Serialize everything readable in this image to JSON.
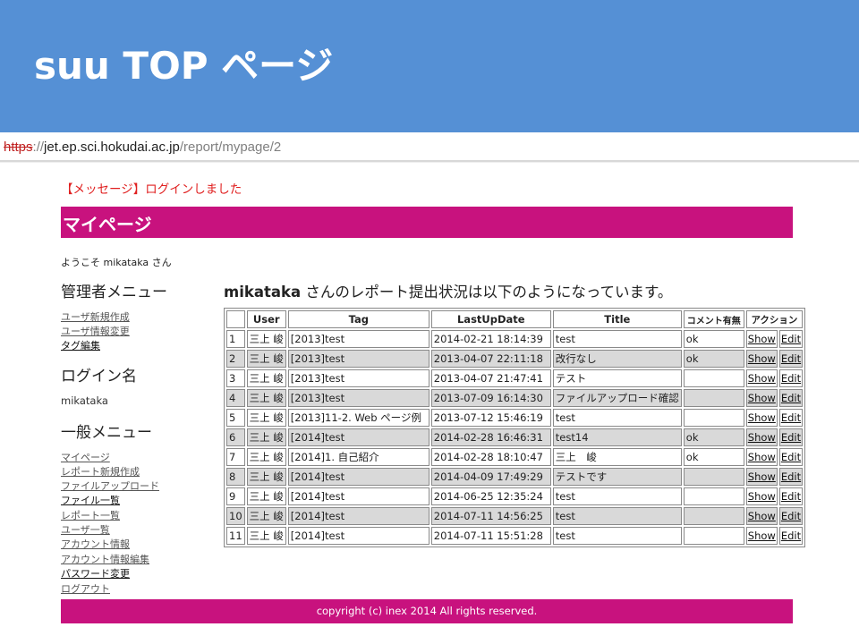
{
  "slide": {
    "title": "suu TOP ページ"
  },
  "browser": {
    "url_scheme": "https",
    "url_sep": "://",
    "url_host": "jet.ep.sci.hokudai.ac.jp",
    "url_path": "/report/mypage/2"
  },
  "flash_message": "【メッセージ】ログインしました",
  "banner_title": "マイページ",
  "welcome": "ようこそ mikataka さん",
  "sidebar": {
    "admin_heading": "管理者メニュー",
    "admin_links": [
      "ユーザ新規作成",
      "ユーザ情報変更",
      "タグ編集"
    ],
    "login_heading": "ログイン名",
    "login_name": "mikataka",
    "general_heading": "一般メニュー",
    "general_links": [
      "マイページ",
      "レポート新規作成",
      "ファイルアップロード",
      "ファイル一覧",
      "レポート一覧",
      "ユーザ一覧",
      "アカウント情報",
      "アカウント情報編集",
      "パスワード変更",
      "ログアウト"
    ]
  },
  "main": {
    "heading_user": "mikataka",
    "heading_rest": " さんのレポート提出状況は以下のようになっています。"
  },
  "table": {
    "headers": [
      "",
      "User",
      "Tag",
      "LastUpDate",
      "Title",
      "コメント有無",
      "アクション"
    ],
    "show_label": "Show",
    "edit_label": "Edit",
    "rows": [
      [
        "1",
        "三上 峻",
        "[2013]test",
        "2014-02-21 18:14:39",
        "test",
        "ok"
      ],
      [
        "2",
        "三上 峻",
        "[2013]test",
        "2013-04-07 22:11:18",
        "改行なし",
        "ok"
      ],
      [
        "3",
        "三上 峻",
        "[2013]test",
        "2013-04-07 21:47:41",
        "テスト",
        ""
      ],
      [
        "4",
        "三上 峻",
        "[2013]test",
        "2013-07-09 16:14:30",
        "ファイルアップロード確認",
        ""
      ],
      [
        "5",
        "三上 峻",
        "[2013]11-2. Web ページ例",
        "2013-07-12 15:46:19",
        "test",
        ""
      ],
      [
        "6",
        "三上 峻",
        "[2014]test",
        "2014-02-28 16:46:31",
        "test14",
        "ok"
      ],
      [
        "7",
        "三上 峻",
        "[2014]1. 自己紹介",
        "2014-02-28 18:10:47",
        "三上　峻",
        "ok"
      ],
      [
        "8",
        "三上 峻",
        "[2014]test",
        "2014-04-09 17:49:29",
        "テストです",
        ""
      ],
      [
        "9",
        "三上 峻",
        "[2014]test",
        "2014-06-25 12:35:24",
        "test",
        ""
      ],
      [
        "10",
        "三上 峻",
        "[2014]test",
        "2014-07-11 14:56:25",
        "test",
        ""
      ],
      [
        "11",
        "三上 峻",
        "[2014]test",
        "2014-07-11 15:51:28",
        "test",
        ""
      ]
    ]
  },
  "footer": "copyright (c) inex 2014 All rights reserved."
}
